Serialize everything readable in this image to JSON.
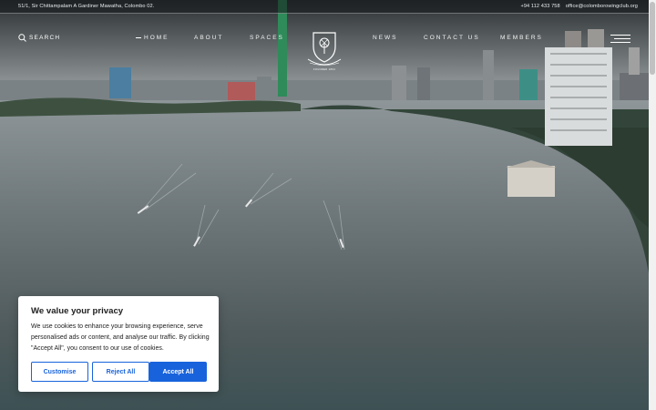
{
  "topbar": {
    "address": "51/1, Sir Chittampalam A Gardiner Mawatha, Colombo 02.",
    "phone": "+94 112 433 758",
    "email": "office@colomborowingclub.org"
  },
  "nav": {
    "search_label": "SEARCH",
    "left_links": [
      "HOME",
      "ABOUT",
      "SPACES"
    ],
    "right_links": [
      "NEWS",
      "CONTACT US",
      "MEMBERS"
    ],
    "logo_caption": "FOUNDED 1864"
  },
  "cookie": {
    "title": "We value your privacy",
    "body": "We use cookies to enhance your browsing experience, serve personalised ads or content, and analyse our traffic. By clicking \"Accept All\", you consent to our use of cookies.",
    "buttons": {
      "customise": "Customise",
      "reject": "Reject All",
      "accept": "Accept All"
    }
  },
  "colors": {
    "accent": "#1863dc",
    "topbar_bg": "#14181a"
  }
}
